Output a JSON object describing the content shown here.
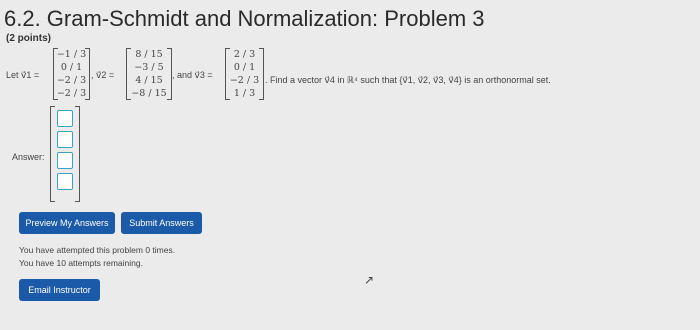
{
  "page": {
    "title": "6.2. Gram-Schmidt and Normalization: Problem 3",
    "points": "(2 points)"
  },
  "problem": {
    "let_v1": "Let v⃗1 =",
    "v2_eq": ", v⃗2 =",
    "v3_eq": ", and v⃗3 =",
    "v1": [
      "−1 / 3",
      "0 / 1",
      "−2 / 3",
      "−2 / 3"
    ],
    "v2": [
      "8 / 15",
      "−3 / 5",
      "4 / 15",
      "−8 / 15"
    ],
    "v3": [
      "2 / 3",
      "0 / 1",
      "−2 / 3",
      "1 / 3"
    ],
    "statement": ". Find a vector v⃗4 in ℝ⁴ such that {v⃗1, v⃗2, v⃗3, v⃗4} is an orthonormal set."
  },
  "answer": {
    "label": "Answer:",
    "values": [
      "",
      "",
      "",
      ""
    ]
  },
  "buttons": {
    "preview": "Preview My Answers",
    "submit": "Submit Answers",
    "email": "Email Instructor"
  },
  "status": {
    "attempted": "You have attempted this problem 0 times.",
    "remaining": "You have 10 attempts remaining."
  }
}
